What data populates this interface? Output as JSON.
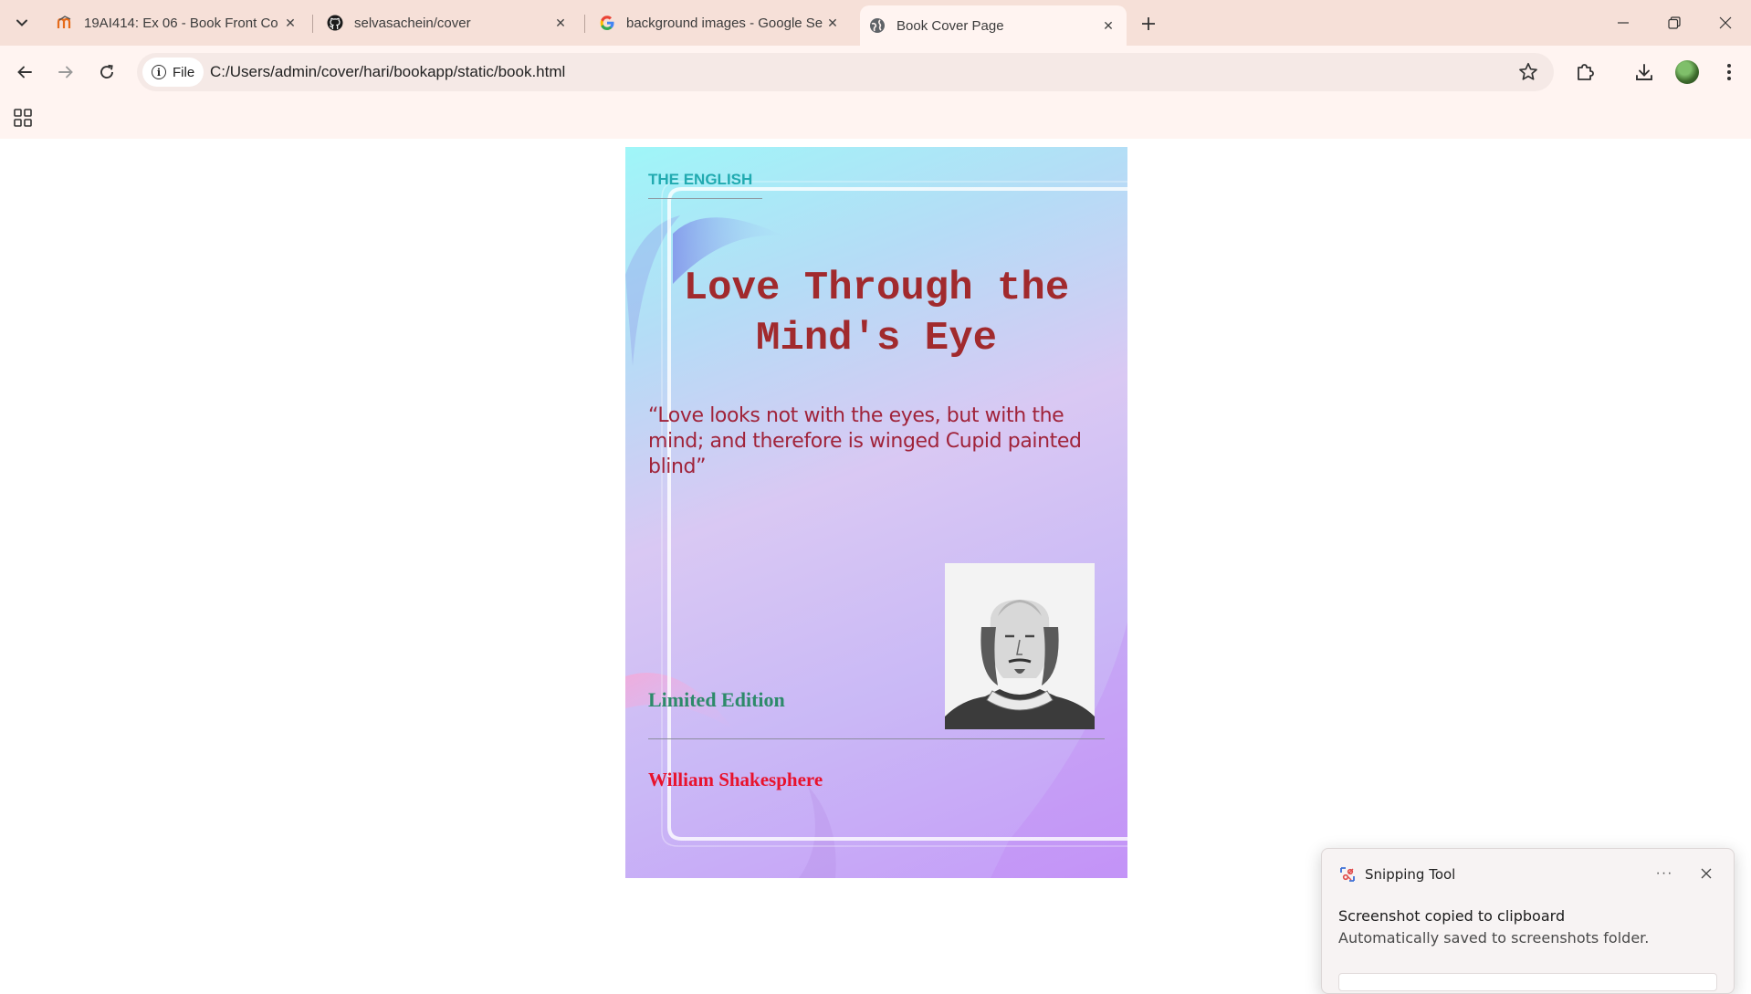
{
  "browser": {
    "tabs": [
      {
        "title": "19AI414: Ex 06 - Book Front Co",
        "favicon": "moodle-icon",
        "active": false
      },
      {
        "title": "selvasachein/cover",
        "favicon": "github-icon",
        "active": false
      },
      {
        "title": "background images - Google Se",
        "favicon": "google-icon",
        "active": false
      },
      {
        "title": "Book Cover Page",
        "favicon": "globe-icon",
        "active": true
      }
    ],
    "address_bar": {
      "scheme_label": "File",
      "url": "C:/Users/admin/cover/hari/bookapp/static/book.html"
    }
  },
  "cover": {
    "series": "THE ENGLISH",
    "title": "Love Through the Mind's Eye",
    "quote": "“Love looks not with the eyes, but with the mind; and therefore is winged Cupid painted blind”",
    "edition": "Limited Edition",
    "author": "William Shakesphere",
    "colors": {
      "series": "#21aab0",
      "title": "#a12a2d",
      "quote": "#a0233a",
      "edition": "#2d8a6a",
      "author": "#e8122c"
    }
  },
  "toast": {
    "app_name": "Snipping Tool",
    "heading": "Screenshot copied to clipboard",
    "message": "Automatically saved to screenshots folder."
  }
}
